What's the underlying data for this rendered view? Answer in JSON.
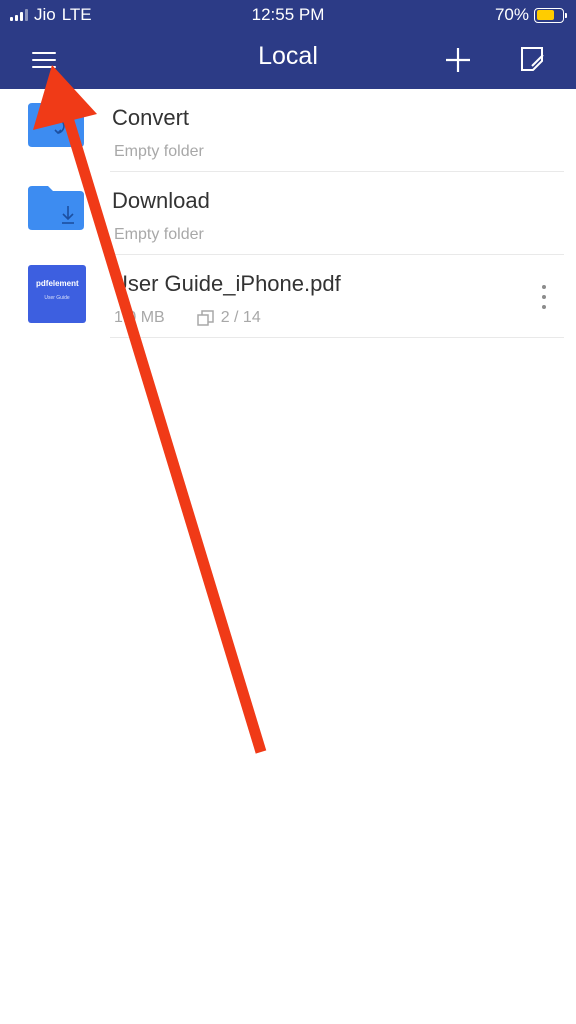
{
  "status_bar": {
    "carrier": "Jio",
    "network": "LTE",
    "time": "12:55 PM",
    "battery_percent": "70%",
    "battery_level": 0.7
  },
  "nav": {
    "title": "Local",
    "menu_icon": "hamburger-menu-icon",
    "add_icon": "plus-icon",
    "edit_icon": "edit-icon"
  },
  "files": [
    {
      "name": "Convert",
      "subtitle": "Empty folder",
      "icon": "folder-convert-icon"
    },
    {
      "name": "Download",
      "subtitle": "Empty folder",
      "icon": "folder-download-icon"
    },
    {
      "name": "User Guide_iPhone.pdf",
      "size": "1.0 MB",
      "pages": "2 / 14",
      "thumb_title": "pdfelement",
      "thumb_subtitle": "User Guide"
    }
  ],
  "colors": {
    "header": "#2c3b86",
    "folder": "#3d8cf1",
    "pdf_thumb": "#3d5fe0",
    "annotation_arrow": "#f03a17"
  }
}
